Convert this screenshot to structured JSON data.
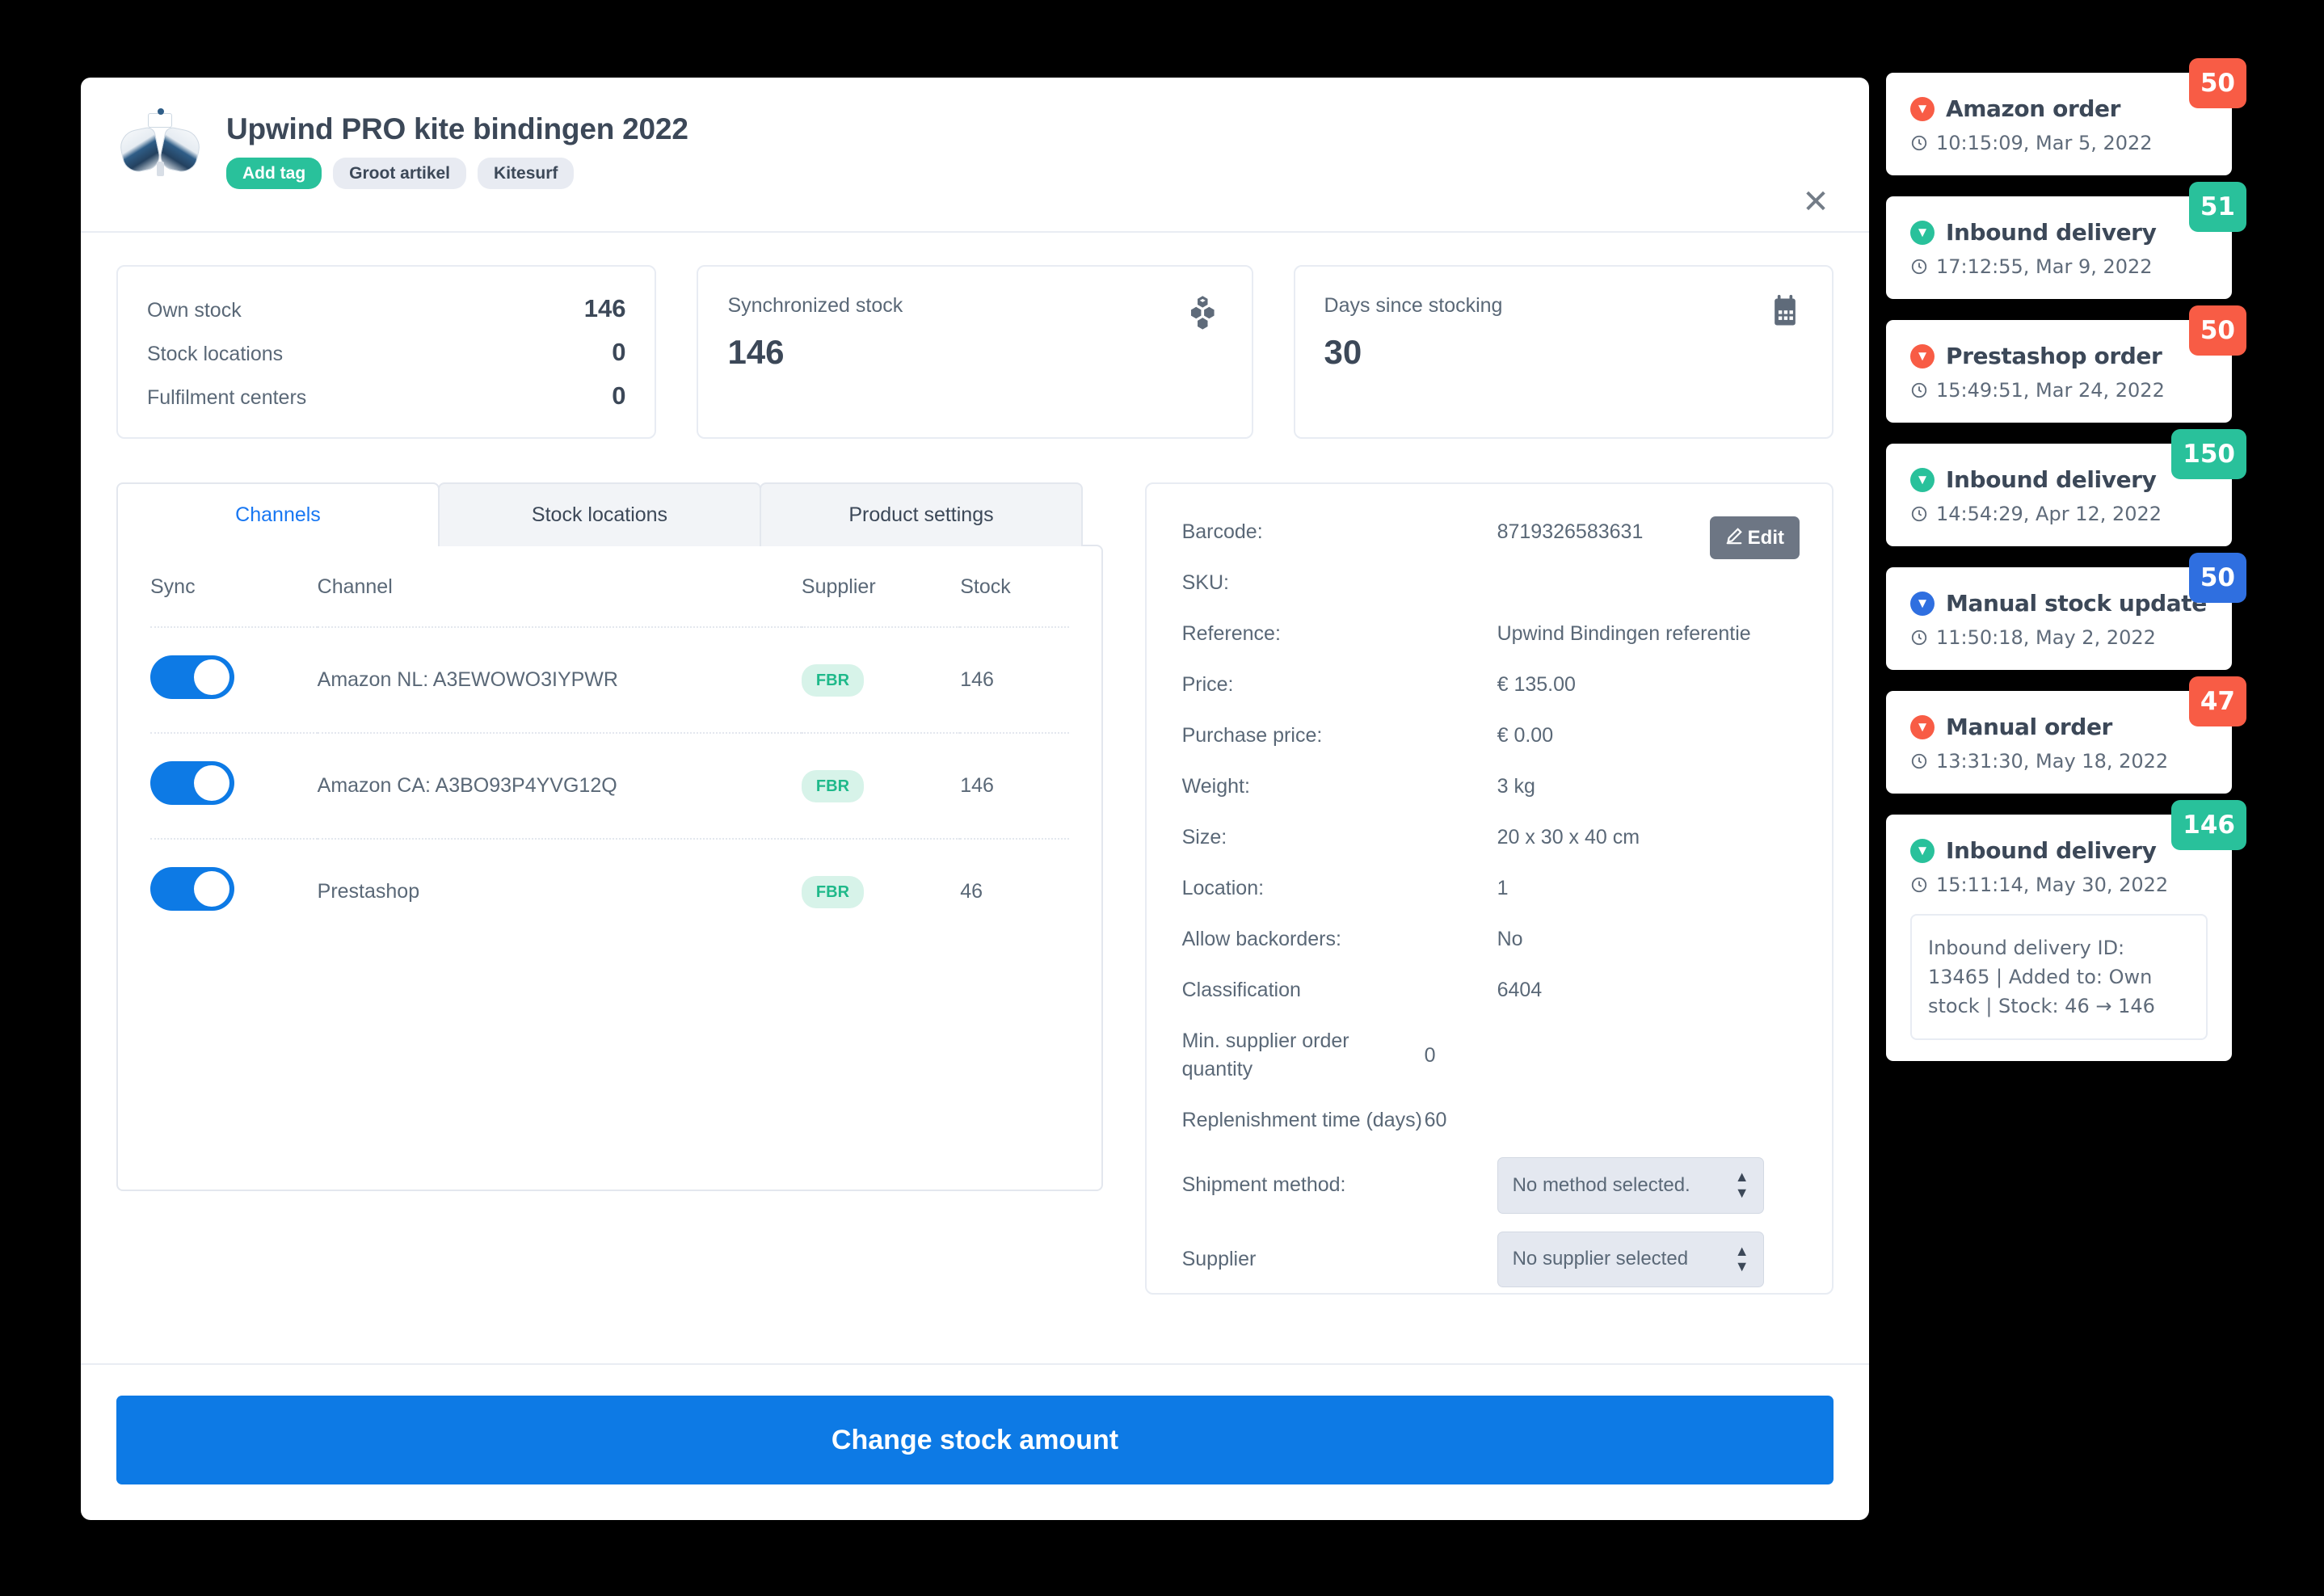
{
  "modal": {
    "product_title": "Upwind PRO kite bindingen 2022",
    "close_label": "✕",
    "tags": [
      {
        "label": "Add tag",
        "style": "add"
      },
      {
        "label": "Groot artikel",
        "style": "plain"
      },
      {
        "label": "Kitesurf",
        "style": "plain"
      }
    ],
    "thumbnail_alt": "kite-bindings-product-photo"
  },
  "stats": {
    "own_stock": {
      "rows": [
        {
          "label": "Own stock",
          "value": "146"
        },
        {
          "label": "Stock locations",
          "value": "0"
        },
        {
          "label": "Fulfilment centers",
          "value": "0"
        }
      ]
    },
    "synchronized": {
      "label": "Synchronized stock",
      "value": "146",
      "icon": "cubes-icon"
    },
    "days": {
      "label": "Days since stocking",
      "value": "30",
      "icon": "calendar-icon"
    }
  },
  "tabs": [
    {
      "label": "Channels",
      "active": true
    },
    {
      "label": "Stock locations",
      "active": false
    },
    {
      "label": "Product settings",
      "active": false
    }
  ],
  "channels_table": {
    "headers": [
      "Sync",
      "Channel",
      "Supplier",
      "Stock"
    ],
    "rows": [
      {
        "sync": true,
        "channel": "Amazon NL: A3EWOWO3IYPWR",
        "supplier": "FBR",
        "stock": "146"
      },
      {
        "sync": true,
        "channel": "Amazon CA: A3BO93P4YVG12Q",
        "supplier": "FBR",
        "stock": "146"
      },
      {
        "sync": true,
        "channel": "Prestashop",
        "supplier": "FBR",
        "stock": "46"
      }
    ]
  },
  "details": {
    "edit_label": "Edit",
    "rows": [
      {
        "label": "Barcode:",
        "value": "8719326583631"
      },
      {
        "label": "SKU:",
        "value": ""
      },
      {
        "label": "Reference:",
        "value": "Upwind Bindingen referentie"
      },
      {
        "label": "Price:",
        "value": "€ 135.00"
      },
      {
        "label": "Purchase price:",
        "value": "€ 0.00"
      },
      {
        "label": "Weight:",
        "value": "3 kg"
      },
      {
        "label": "Size:",
        "value": "20 x 30 x 40 cm"
      },
      {
        "label": "Location:",
        "value": "1"
      },
      {
        "label": "Allow backorders:",
        "value": "No"
      },
      {
        "label": "Classification",
        "value": "6404"
      },
      {
        "label": "Min. supplier order quantity",
        "value": "0"
      },
      {
        "label": "Replenishment time (days)",
        "value": "60"
      }
    ],
    "selects": [
      {
        "label": "Shipment method:",
        "value": "No method selected."
      },
      {
        "label": "Supplier",
        "value": "No supplier selected"
      }
    ]
  },
  "footer": {
    "primary_label": "Change stock amount"
  },
  "timeline": [
    {
      "title": "Amazon order",
      "time": "10:15:09, Mar 5, 2022",
      "badge": "50",
      "color": "#f85c45",
      "detail": null
    },
    {
      "title": "Inbound delivery",
      "time": "17:12:55, Mar 9, 2022",
      "badge": "51",
      "color": "#29c19b",
      "detail": null
    },
    {
      "title": "Prestashop order",
      "time": "15:49:51, Mar 24, 2022",
      "badge": "50",
      "color": "#f85c45",
      "detail": null
    },
    {
      "title": "Inbound delivery",
      "time": "14:54:29, Apr 12, 2022",
      "badge": "150",
      "color": "#29c19b",
      "detail": null
    },
    {
      "title": "Manual stock update",
      "time": "11:50:18, May 2, 2022",
      "badge": "50",
      "color": "#2f6fe0",
      "detail": null
    },
    {
      "title": "Manual order",
      "time": "13:31:30, May 18, 2022",
      "badge": "47",
      "color": "#f85c45",
      "detail": null
    },
    {
      "title": "Inbound delivery",
      "time": "15:11:14, May 30, 2022",
      "badge": "146",
      "color": "#29c19b",
      "detail": "Inbound delivery ID: 13465 | Added to: Own stock | Stock: 46 → 146"
    }
  ],
  "colors": {
    "primary_blue": "#0d7ae5",
    "teal": "#29c19b",
    "red": "#f85c45",
    "blue_badge": "#2f6fe0",
    "text_dark": "#3c4858",
    "text_muted": "#5a6877",
    "border": "#e8ecf3",
    "tab_inactive_bg": "#f2f4f7"
  }
}
